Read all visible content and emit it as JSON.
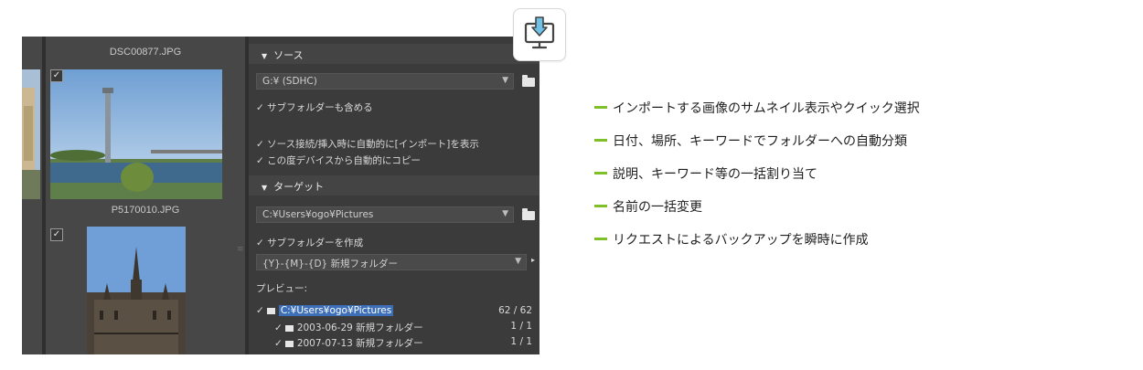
{
  "colors": {
    "accent_green": "#7fbf2a",
    "panel_bg": "#3b3b3b",
    "selection_blue": "#3d6fb8"
  },
  "thumbnails": {
    "top_filename": "DSC00877.JPG",
    "bottom_filename": "P5170010.JPG",
    "checkmark": "✓"
  },
  "source_section": {
    "header": "ソース",
    "drive_value": "G:¥ (SDHC)",
    "include_subfolders": "サブフォルダーも含める",
    "show_import_on_connect": "ソース接続/挿入時に自動的に[インポート]を表示",
    "auto_copy_from_device": "この度デバイスから自動的にコピー"
  },
  "target_section": {
    "header": "ターゲット",
    "path_value": "C:¥Users¥ogo¥Pictures",
    "create_subfolder": "サブフォルダーを作成",
    "folder_name_pattern": "{Y}-{M}-{D} 新規フォルダー",
    "preview_label": "プレビュー:"
  },
  "preview_tree": [
    {
      "label": "C:¥Users¥ogo¥Pictures",
      "count": "62 / 62"
    },
    {
      "label": "2003-06-29 新規フォルダー",
      "count": "1 / 1"
    },
    {
      "label": "2007-07-13 新規フォルダー",
      "count": "1 / 1"
    }
  ],
  "icons": {
    "import": "import-to-monitor-icon",
    "folder": "folder-icon",
    "caret": "caret-down-icon"
  },
  "features": [
    "インポートする画像のサムネイル表示やクイック選択",
    "日付、場所、キーワードでフォルダーへの自動分類",
    "説明、キーワード等の一括割り当て",
    "名前の一括変更",
    "リクエストによるバックアップを瞬時に作成"
  ]
}
